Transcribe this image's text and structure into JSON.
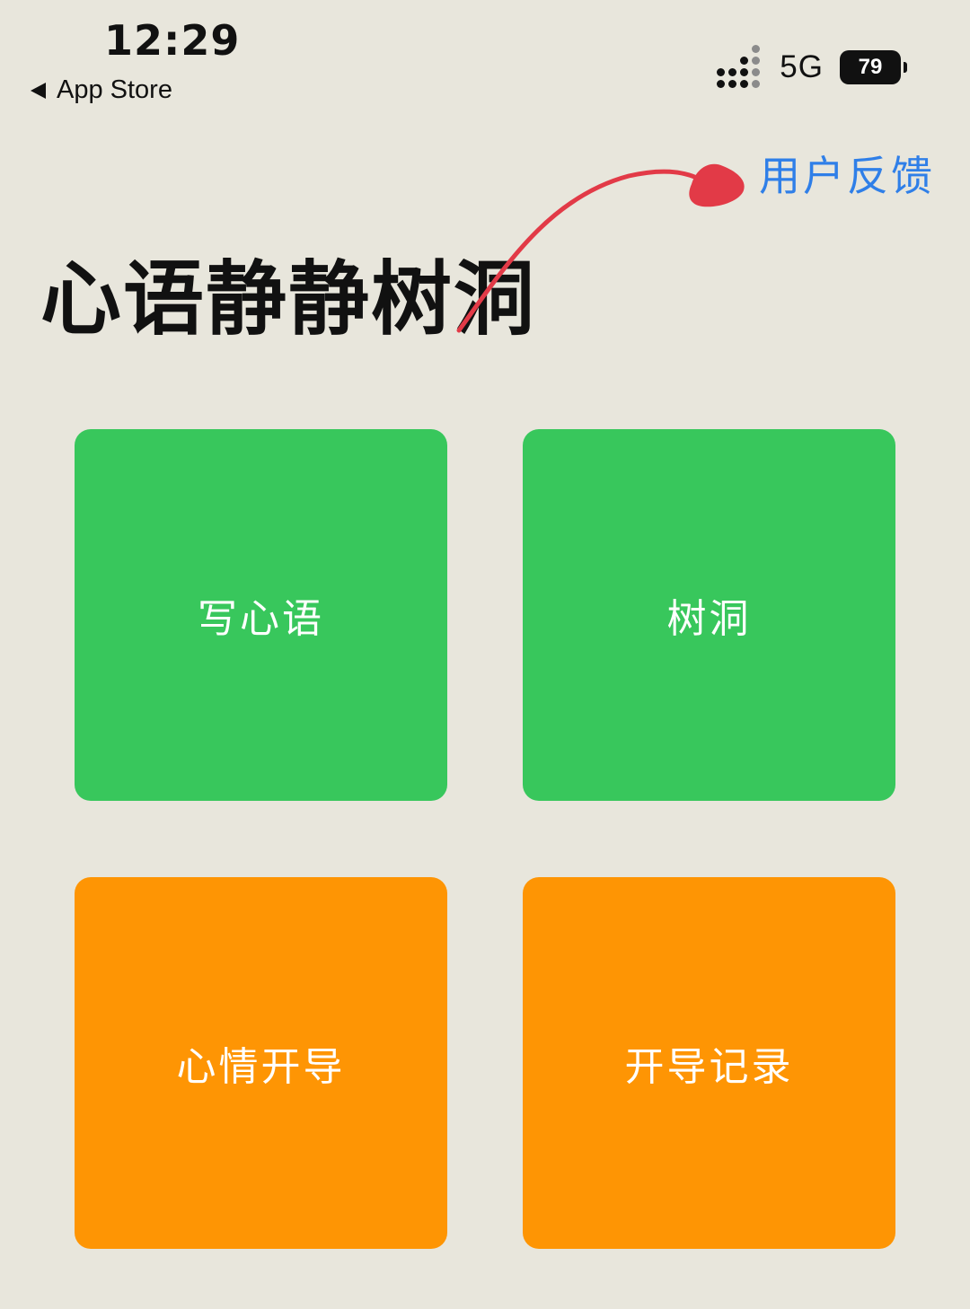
{
  "status_bar": {
    "time": "12:29",
    "back_label": "App Store",
    "network": "5G",
    "battery": "79"
  },
  "header": {
    "feedback_label": "用户反馈",
    "title": "心语静静树洞"
  },
  "tiles": [
    {
      "label": "写心语",
      "color": "#38C75C"
    },
    {
      "label": "树洞",
      "color": "#38C75C"
    },
    {
      "label": "心情开导",
      "color": "#FE9504"
    },
    {
      "label": "开导记录",
      "color": "#FE9504"
    }
  ],
  "colors": {
    "background": "#E8E6DC",
    "link": "#2F7FE8",
    "annotation": "#E23A47"
  },
  "icons": {
    "back": "back-chevron-icon",
    "signal": "cellular-signal-icon",
    "battery": "battery-icon"
  }
}
